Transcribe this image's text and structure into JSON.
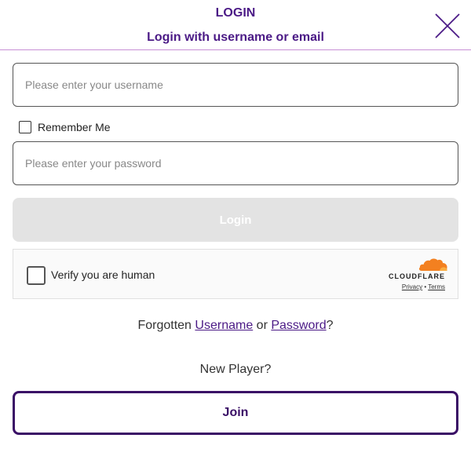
{
  "header": {
    "title": "LOGIN",
    "subtitle": "Login with username or email",
    "close_icon": "close-icon"
  },
  "form": {
    "username_placeholder": "Please enter your username",
    "username_value": "",
    "remember_label": "Remember Me",
    "remember_checked": false,
    "password_placeholder": "Please enter your password",
    "password_value": "",
    "login_label": "Login"
  },
  "captcha": {
    "label": "Verify you are human",
    "brand": "CLOUDFLARE",
    "privacy": "Privacy",
    "separator": "•",
    "terms": "Terms",
    "logo_icon": "cloudflare-logo-icon",
    "accent_color": "#f38020"
  },
  "forgot": {
    "prefix": "Forgotten",
    "username_link": "Username",
    "middle": "or",
    "password_link": "Password",
    "suffix": "?"
  },
  "signup": {
    "prompt": "New Player?",
    "join_label": "Join"
  },
  "colors": {
    "brand_purple": "#4b1a86",
    "join_border": "#3a0f66",
    "login_disabled_bg": "#e3e3e3",
    "divider": "#c88fd6"
  }
}
